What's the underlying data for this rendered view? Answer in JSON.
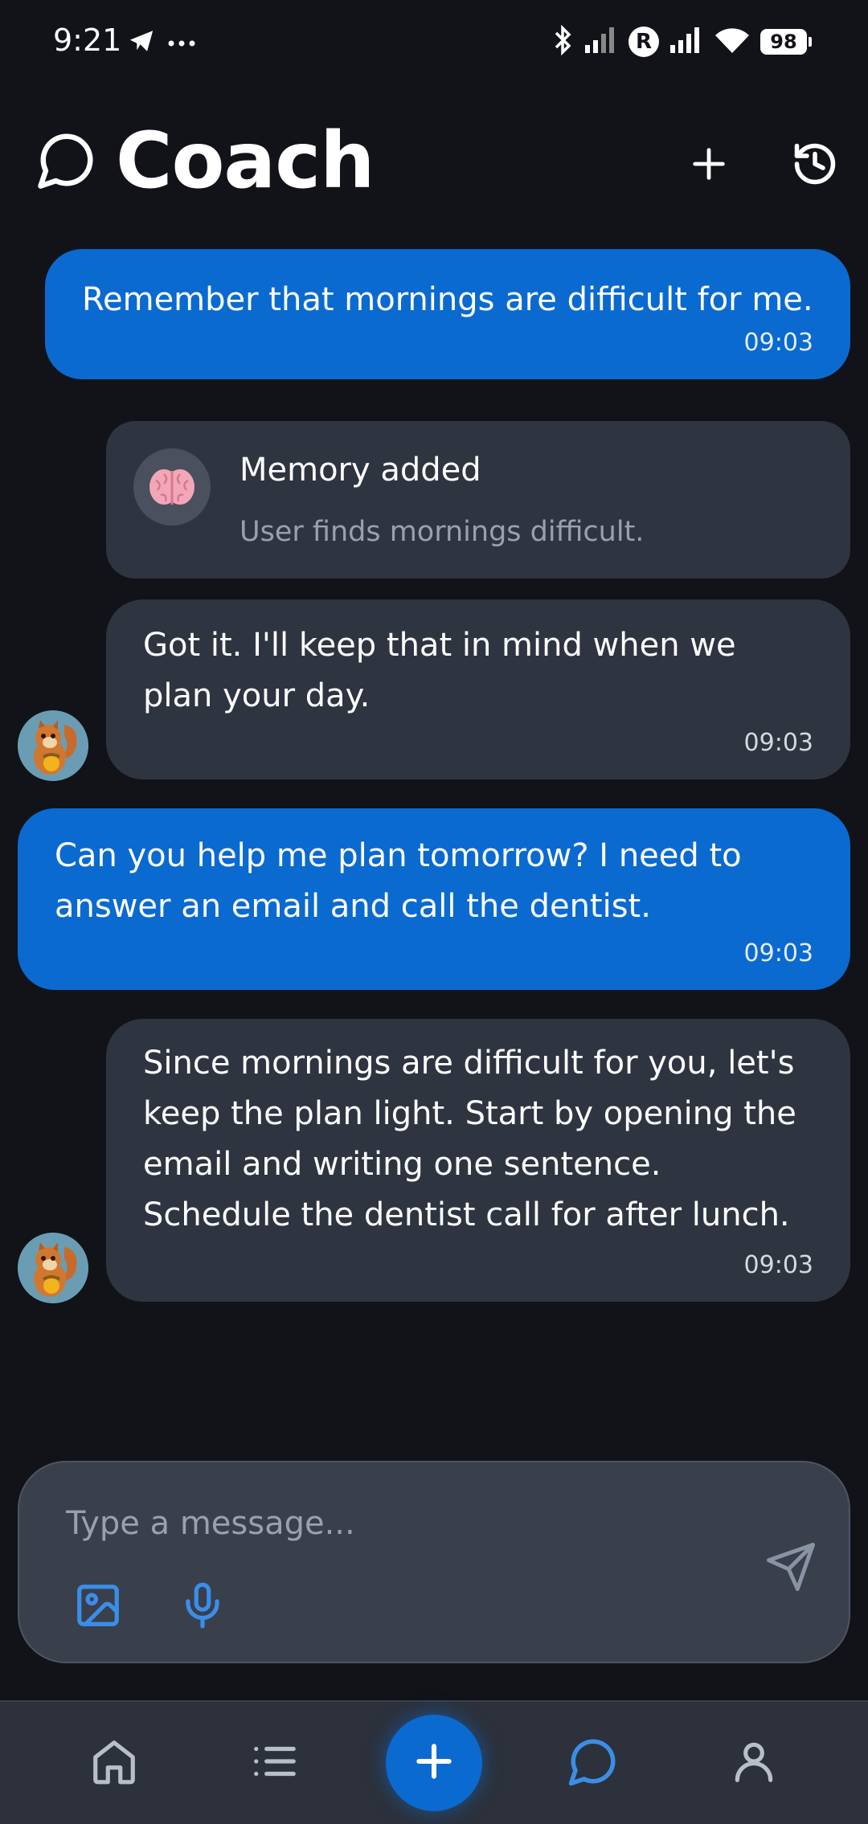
{
  "status_bar": {
    "time": "9:21",
    "battery": "98",
    "roaming_badge": "R",
    "icons": [
      "telegram-icon",
      "more-dots-icon",
      "bluetooth-icon",
      "signal-icon",
      "wifi-icon",
      "battery-icon"
    ]
  },
  "header": {
    "title": "Coach",
    "icons": [
      "chat-bubble-icon",
      "plus-icon",
      "history-icon"
    ]
  },
  "messages": [
    {
      "role": "user",
      "text": "Remember that mornings are difficult for me.",
      "time": "09:03"
    },
    {
      "role": "memory",
      "title": "Memory added",
      "subtitle": "User finds mornings difficult.",
      "icon": "brain-icon"
    },
    {
      "role": "bot",
      "line1": "Got it. I'll keep that in mind when we",
      "line2": "plan your day.",
      "time": "09:03"
    },
    {
      "role": "user",
      "line1": "Can you help me plan tomorrow? I need to",
      "line2": "answer an email and call the dentist.",
      "time": "09:03"
    },
    {
      "role": "bot",
      "line1": "Since mornings are difficult for you, let's",
      "line2": "keep the plan light. Start by opening the",
      "line3": "email and writing one sentence.",
      "line4": "Schedule the dentist call for after lunch.",
      "time": "09:03"
    }
  ],
  "composer": {
    "placeholder": "Type a message...",
    "icons": [
      "image-icon",
      "microphone-icon",
      "send-icon"
    ]
  },
  "bottom_nav": {
    "items": [
      "home-icon",
      "list-icon",
      "add-icon",
      "chat-icon",
      "profile-icon"
    ],
    "active": "chat-icon"
  },
  "colors": {
    "background": "#111318",
    "user_bubble": "#0a6ad0",
    "bot_bubble": "#2f3441",
    "accent": "#3b8ee8"
  }
}
